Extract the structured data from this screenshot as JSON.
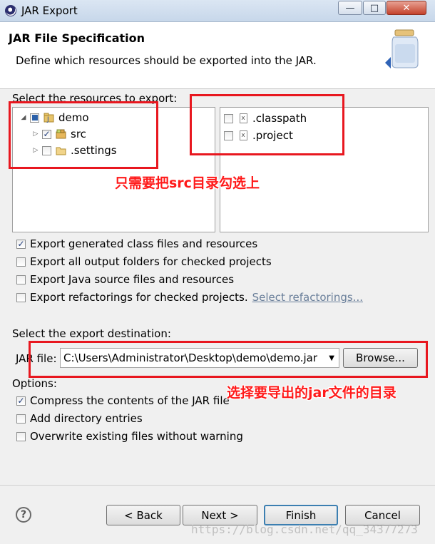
{
  "window": {
    "title": "JAR Export",
    "controls": {
      "minimize": "—",
      "maximize": "□",
      "close": "✕"
    }
  },
  "header": {
    "title": "JAR File Specification",
    "description": "Define which resources should be exported into the JAR."
  },
  "resources": {
    "label": "Select the resources to export:",
    "tree": [
      {
        "label": "demo",
        "expanded": true,
        "check": "partial",
        "icon": "java-project-icon"
      },
      {
        "label": "src",
        "expanded": false,
        "check": "checked",
        "icon": "package-folder-icon"
      },
      {
        "label": ".settings",
        "expanded": false,
        "check": "unchecked",
        "icon": "folder-icon"
      }
    ],
    "files": [
      {
        "label": ".classpath",
        "check": "unchecked",
        "icon": "xml-file-icon"
      },
      {
        "label": ".project",
        "check": "unchecked",
        "icon": "xml-file-icon"
      }
    ]
  },
  "export_options": [
    {
      "label": "Export generated class files and resources",
      "checked": true
    },
    {
      "label": "Export all output folders for checked projects",
      "checked": false
    },
    {
      "label": "Export Java source files and resources",
      "checked": false
    },
    {
      "label": "Export refactorings for checked projects.",
      "checked": false,
      "link": "Select refactorings..."
    }
  ],
  "destination": {
    "label": "Select the export destination:",
    "jar_label": "JAR file:",
    "jar_value": "C:\\Users\\Administrator\\Desktop\\demo\\demo.jar",
    "browse": "Browse..."
  },
  "options": {
    "label": "Options:",
    "items": [
      {
        "label": "Compress the contents of the JAR file",
        "checked": true
      },
      {
        "label": "Add directory entries",
        "checked": false
      },
      {
        "label": "Overwrite existing files without warning",
        "checked": false
      }
    ]
  },
  "buttons": {
    "back": "< Back",
    "next": "Next >",
    "finish": "Finish",
    "cancel": "Cancel"
  },
  "annotations": {
    "src_note": "只需要把src目录勾选上",
    "jar_note": "选择要导出的jar文件的目录"
  },
  "watermark": "https://blog.csdn.net/qq_34377273",
  "colors": {
    "annotation_red": "#e8171f",
    "link": "#6a7f9a",
    "finish_border": "#3c7fb1"
  }
}
